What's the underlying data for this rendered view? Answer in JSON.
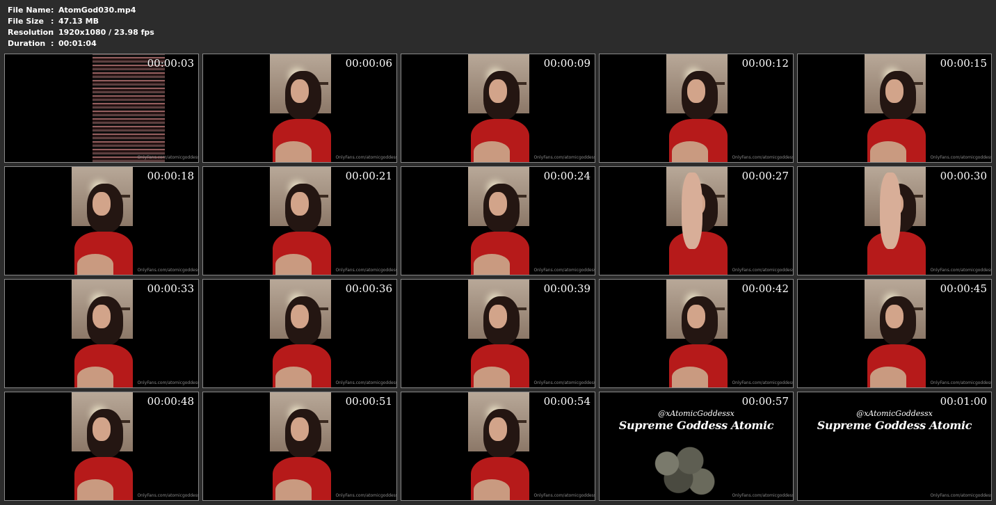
{
  "file_info": {
    "name_label": "File Name",
    "name_value": "AtomGod030.mp4",
    "size_label": "File Size",
    "size_value": "47.13 MB",
    "resolution_label": "Resolution",
    "resolution_value": "1920x1080 / 23.98 fps",
    "duration_label": "Duration",
    "duration_value": "00:01:04",
    "separator": ":"
  },
  "thumbnails": [
    {
      "timestamp": "00:00:03",
      "watermark": "OnlyFans.com/atomicgoddess",
      "scene": "glitch"
    },
    {
      "timestamp": "00:00:06",
      "watermark": "OnlyFans.com/atomicgoddess",
      "scene": "woman-red"
    },
    {
      "timestamp": "00:00:09",
      "watermark": "OnlyFans.com/atomicgoddess",
      "scene": "woman-red"
    },
    {
      "timestamp": "00:00:12",
      "watermark": "OnlyFans.com/atomicgoddess",
      "scene": "woman-red"
    },
    {
      "timestamp": "00:00:15",
      "watermark": "OnlyFans.com/atomicgoddess",
      "scene": "woman-red"
    },
    {
      "timestamp": "00:00:18",
      "watermark": "OnlyFans.com/atomicgoddess",
      "scene": "woman-red"
    },
    {
      "timestamp": "00:00:21",
      "watermark": "OnlyFans.com/atomicgoddess",
      "scene": "woman-red"
    },
    {
      "timestamp": "00:00:24",
      "watermark": "OnlyFans.com/atomicgoddess",
      "scene": "woman-red"
    },
    {
      "timestamp": "00:00:27",
      "watermark": "OnlyFans.com/atomicgoddess",
      "scene": "foot"
    },
    {
      "timestamp": "00:00:30",
      "watermark": "OnlyFans.com/atomicgoddess",
      "scene": "foot"
    },
    {
      "timestamp": "00:00:33",
      "watermark": "OnlyFans.com/atomicgoddess",
      "scene": "woman-red"
    },
    {
      "timestamp": "00:00:36",
      "watermark": "OnlyFans.com/atomicgoddess",
      "scene": "woman-red"
    },
    {
      "timestamp": "00:00:39",
      "watermark": "OnlyFans.com/atomicgoddess",
      "scene": "woman-red"
    },
    {
      "timestamp": "00:00:42",
      "watermark": "OnlyFans.com/atomicgoddess",
      "scene": "woman-red"
    },
    {
      "timestamp": "00:00:45",
      "watermark": "OnlyFans.com/atomicgoddess",
      "scene": "woman-red"
    },
    {
      "timestamp": "00:00:48",
      "watermark": "OnlyFans.com/atomicgoddess",
      "scene": "woman-red"
    },
    {
      "timestamp": "00:00:51",
      "watermark": "OnlyFans.com/atomicgoddess",
      "scene": "woman-red"
    },
    {
      "timestamp": "00:00:54",
      "watermark": "OnlyFans.com/atomicgoddess",
      "scene": "woman-red"
    },
    {
      "timestamp": "00:00:57",
      "watermark": "OnlyFans.com/atomicgoddess",
      "scene": "title-smoke",
      "handle": "@xAtomicGoddessx",
      "brand": "Supreme Goddess Atomic"
    },
    {
      "timestamp": "00:01:00",
      "watermark": "OnlyFans.com/atomicgoddess",
      "scene": "title",
      "handle": "@xAtomicGoddessx",
      "brand": "Supreme Goddess Atomic"
    }
  ],
  "colors": {
    "background": "#2c2c2c",
    "thumb_border": "#8a8a8a",
    "accent_red": "#b61a1a"
  }
}
